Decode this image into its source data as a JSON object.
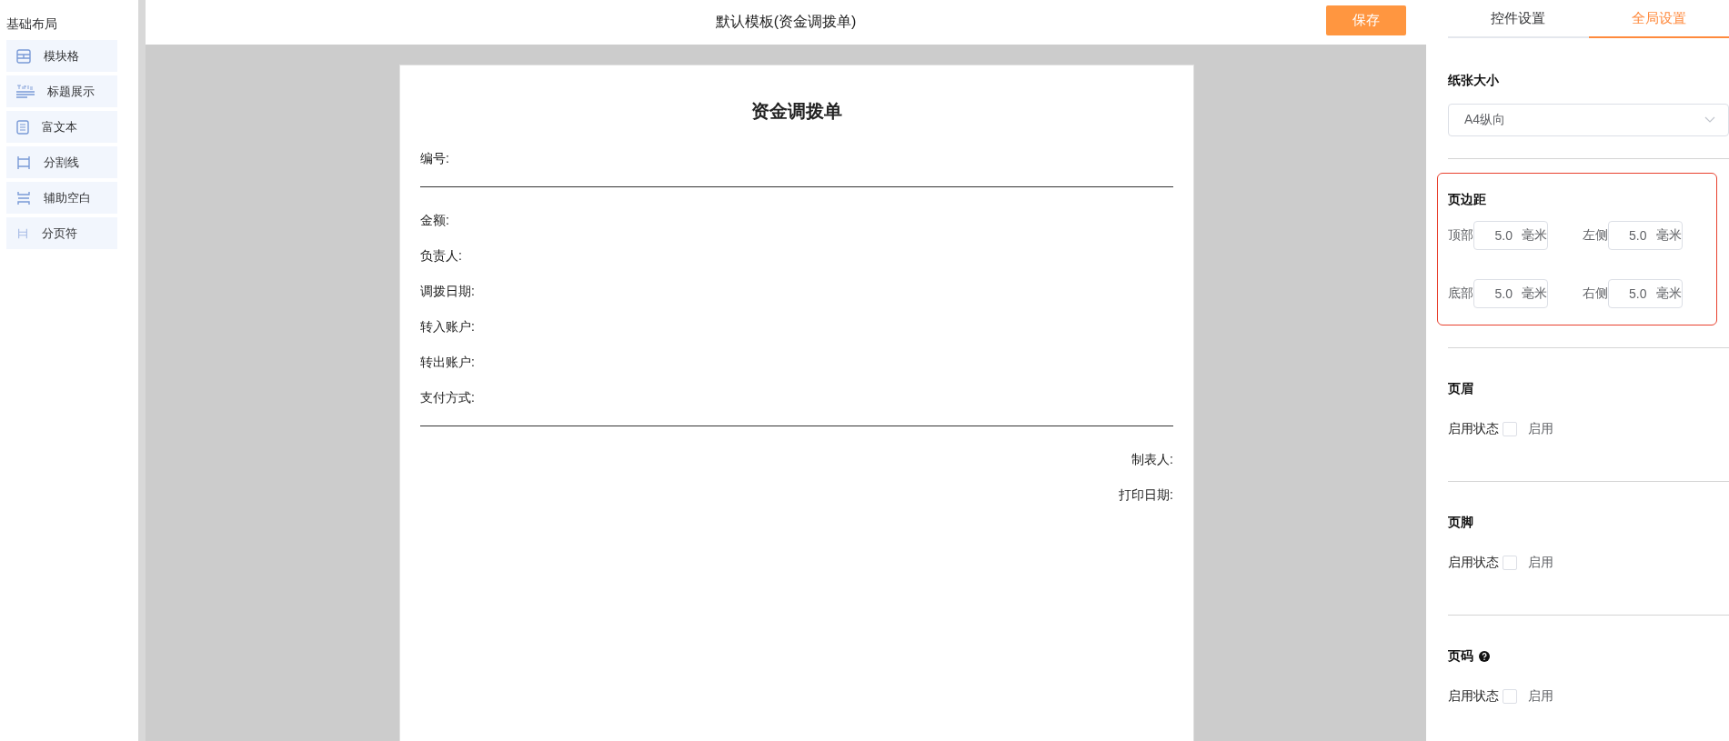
{
  "sidebar": {
    "title": "基础布局",
    "items": [
      {
        "label": "模块格",
        "kind": "grid"
      },
      {
        "label": "标题展示",
        "kind": "title"
      },
      {
        "label": "富文本",
        "kind": "richtext"
      },
      {
        "label": "分割线",
        "kind": "divider"
      },
      {
        "label": "辅助空白",
        "kind": "spacer"
      },
      {
        "label": "分页符",
        "kind": "pagebreak"
      }
    ]
  },
  "header": {
    "title": "默认模板(资金调拨单)",
    "save_button": "保存"
  },
  "document": {
    "title": "资金调拨单",
    "rows": [
      {
        "kind": "field",
        "text": "编号:"
      },
      {
        "kind": "rule"
      },
      {
        "kind": "field",
        "text": "金额:"
      },
      {
        "kind": "field",
        "text": "负责人:"
      },
      {
        "kind": "field",
        "text": "调拨日期:"
      },
      {
        "kind": "field",
        "text": "转入账户:"
      },
      {
        "kind": "field",
        "text": "转出账户:"
      },
      {
        "kind": "field",
        "text": "支付方式:"
      },
      {
        "kind": "rule"
      },
      {
        "kind": "sign",
        "text": "制表人:"
      },
      {
        "kind": "sign",
        "text": "打印日期:"
      }
    ]
  },
  "panel": {
    "tabs": [
      {
        "label": "控件设置",
        "selected": false
      },
      {
        "label": "全局设置",
        "selected": true
      }
    ],
    "paper_size": {
      "label": "纸张大小",
      "value": "A4纵向"
    },
    "margins": {
      "title": "页边距",
      "highlighted": true,
      "fields": [
        {
          "label": "顶部",
          "value": "5.0",
          "unit": "毫米"
        },
        {
          "label": "左侧",
          "value": "5.0",
          "unit": "毫米"
        },
        {
          "label": "底部",
          "value": "5.0",
          "unit": "毫米"
        },
        {
          "label": "右侧",
          "value": "5.0",
          "unit": "毫米"
        }
      ]
    },
    "toggles": [
      {
        "title": "页眉",
        "help": false,
        "status_label": "启用状态",
        "checkbox_label": "启用",
        "checked": false
      },
      {
        "title": "页脚",
        "help": false,
        "status_label": "启用状态",
        "checkbox_label": "启用",
        "checked": false
      },
      {
        "title": "页码",
        "help": true,
        "status_label": "启用状态",
        "checkbox_label": "启用",
        "checked": false
      }
    ]
  }
}
